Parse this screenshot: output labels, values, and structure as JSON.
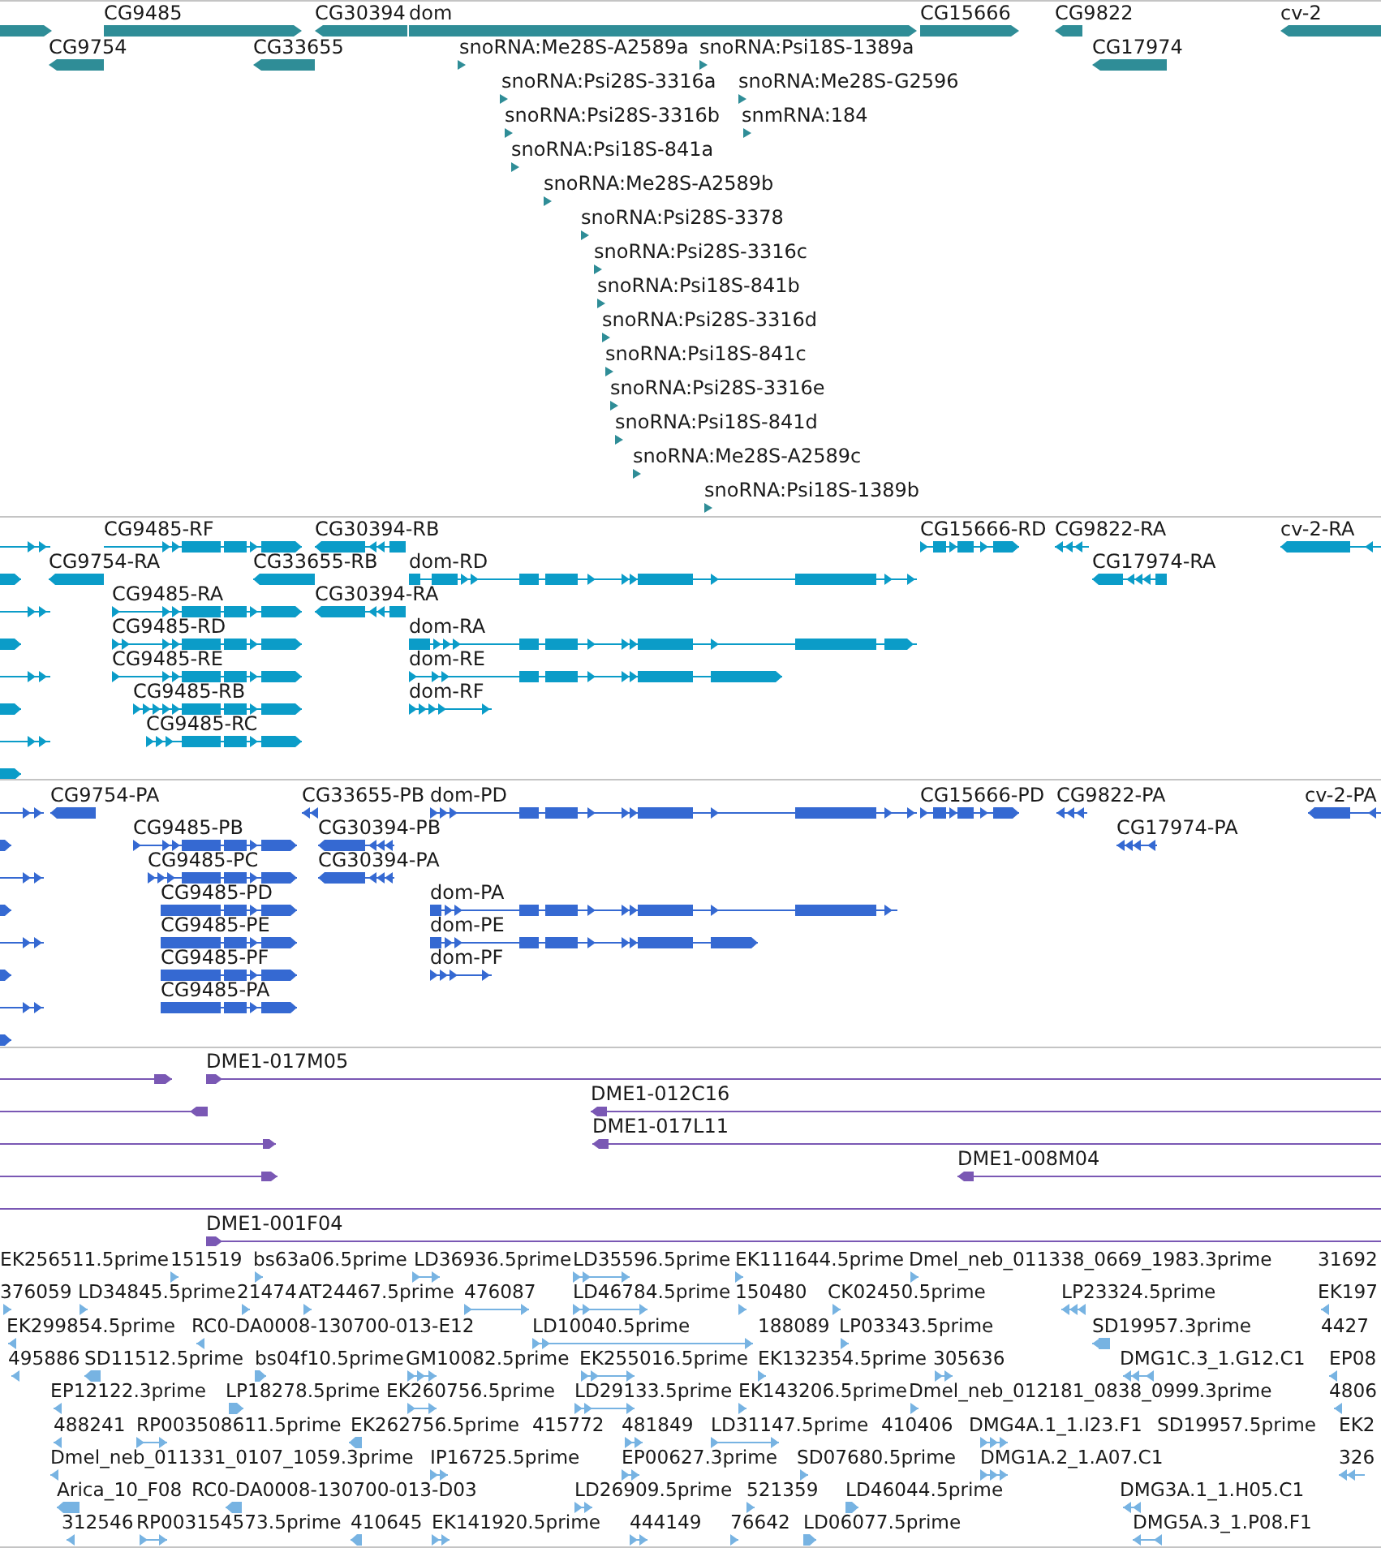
{
  "tracks": [
    {
      "kind": "gene",
      "features": [
        {
          "reverse": false
        },
        {
          "label": "CG9485",
          "reverse": false
        },
        {
          "label": "CG30394",
          "reverse": true
        },
        {
          "label": "dom",
          "reverse": false
        },
        {
          "label": "CG15666",
          "reverse": false
        },
        {
          "label": "CG9822",
          "reverse": true
        },
        {
          "label": "cv-2",
          "reverse": true
        },
        {
          "label": "CG9754",
          "reverse": true
        },
        {
          "label": "CG33655",
          "reverse": true
        },
        {
          "label": "snoRNA:Me28S-A2589a",
          "reverse": false
        },
        {
          "label": "snoRNA:Psi18S-1389a",
          "reverse": false
        },
        {
          "label": "CG17974",
          "reverse": true
        },
        {
          "label": "snoRNA:Psi28S-3316a",
          "reverse": false
        },
        {
          "label": "snoRNA:Me28S-G2596",
          "reverse": false
        },
        {
          "label": "snoRNA:Psi28S-3316b",
          "reverse": false
        },
        {
          "label": "snmRNA:184",
          "reverse": false
        },
        {
          "label": "snoRNA:Psi18S-841a",
          "reverse": false
        },
        {
          "label": "snoRNA:Me28S-A2589b",
          "reverse": false
        },
        {
          "label": "snoRNA:Psi28S-3378",
          "reverse": false
        },
        {
          "label": "snoRNA:Psi28S-3316c",
          "reverse": false
        },
        {
          "label": "snoRNA:Psi18S-841b",
          "reverse": false
        },
        {
          "label": "snoRNA:Psi28S-3316d",
          "reverse": false
        },
        {
          "label": "snoRNA:Psi18S-841c",
          "reverse": false
        },
        {
          "label": "snoRNA:Psi28S-3316e",
          "reverse": false
        },
        {
          "label": "snoRNA:Psi18S-841d",
          "reverse": false
        },
        {
          "label": "snoRNA:Me28S-A2589c",
          "reverse": false
        },
        {
          "label": "snoRNA:Psi18S-1389b",
          "reverse": false
        }
      ]
    },
    {
      "kind": "transcript",
      "features": [
        {
          "reverse": false
        },
        {
          "label": "CG9485-RF",
          "reverse": false
        },
        {
          "label": "CG30394-RB",
          "reverse": true
        },
        {
          "label": "CG15666-RD",
          "reverse": false
        },
        {
          "label": "CG9822-RA",
          "reverse": true
        },
        {
          "label": "cv-2-RA",
          "reverse": true
        },
        {
          "reverse": false
        },
        {
          "label": "CG9754-RA",
          "reverse": true
        },
        {
          "label": "CG33655-RB",
          "reverse": true
        },
        {
          "label": "dom-RD",
          "reverse": false
        },
        {
          "label": "CG17974-RA",
          "reverse": true
        },
        {
          "reverse": false
        },
        {
          "label": "CG9485-RA",
          "reverse": false
        },
        {
          "label": "CG30394-RA",
          "reverse": true
        },
        {
          "reverse": false
        },
        {
          "label": "CG9485-RD",
          "reverse": false
        },
        {
          "label": "dom-RA",
          "reverse": false
        },
        {
          "reverse": false
        },
        {
          "label": "CG9485-RE",
          "reverse": false
        },
        {
          "label": "dom-RE",
          "reverse": false
        },
        {
          "reverse": false
        },
        {
          "label": "CG9485-RB",
          "reverse": false
        },
        {
          "label": "dom-RF",
          "reverse": false
        },
        {
          "reverse": false
        },
        {
          "label": "CG9485-RC",
          "reverse": false
        },
        {
          "reverse": false
        }
      ]
    },
    {
      "kind": "protein",
      "features": [
        {
          "reverse": false
        },
        {
          "label": "CG9754-PA",
          "reverse": true
        },
        {
          "label": "CG33655-PB",
          "reverse": true
        },
        {
          "label": "dom-PD",
          "reverse": false
        },
        {
          "label": "CG15666-PD",
          "reverse": false
        },
        {
          "label": "CG9822-PA",
          "reverse": true
        },
        {
          "label": "cv-2-PA",
          "reverse": true
        },
        {
          "reverse": false
        },
        {
          "label": "CG9485-PB",
          "reverse": false
        },
        {
          "label": "CG30394-PB",
          "reverse": true
        },
        {
          "label": "CG17974-PA",
          "reverse": true
        },
        {
          "reverse": false
        },
        {
          "label": "CG9485-PC",
          "reverse": false
        },
        {
          "label": "CG30394-PA",
          "reverse": true
        },
        {
          "reverse": false
        },
        {
          "label": "CG9485-PD",
          "reverse": false
        },
        {
          "label": "dom-PA",
          "reverse": false
        },
        {
          "reverse": false
        },
        {
          "label": "CG9485-PE",
          "reverse": false
        },
        {
          "label": "dom-PE",
          "reverse": false
        },
        {
          "reverse": false
        },
        {
          "label": "CG9485-PF",
          "reverse": false
        },
        {
          "label": "dom-PF",
          "reverse": false
        },
        {
          "reverse": false
        },
        {
          "label": "CG9485-PA",
          "reverse": false
        },
        {
          "reverse": false
        }
      ]
    },
    {
      "kind": "clone",
      "features": [
        {
          "reverse": false
        },
        {
          "label": "DME1-017M05",
          "reverse": false
        },
        {
          "reverse": true
        },
        {
          "label": "DME1-012C16",
          "reverse": true
        },
        {
          "reverse": false
        },
        {
          "label": "DME1-017L11",
          "reverse": true
        },
        {
          "reverse": false
        },
        {
          "label": "DME1-008M04",
          "reverse": true
        },
        {
          "reverse": false
        },
        {
          "label": "DME1-001F04",
          "reverse": false
        }
      ]
    },
    {
      "kind": "est",
      "features": [
        {
          "label": "EK256511.5prime"
        },
        {
          "label": "151519",
          "reverse": false
        },
        {
          "label": "bs63a06.5prime",
          "reverse": false
        },
        {
          "label": "LD36936.5prime",
          "reverse": false
        },
        {
          "label": "LD35596.5prime",
          "reverse": false
        },
        {
          "label": "EK111644.5prime",
          "reverse": false
        },
        {
          "label": "Dmel_neb_011338_0669_1983.3prime",
          "reverse": false
        },
        {
          "label": "31692"
        },
        {
          "label": "376059",
          "reverse": false
        },
        {
          "label": "LD34845.5prime",
          "reverse": false
        },
        {
          "label": "21474",
          "reverse": false
        },
        {
          "label": "AT24467.5prime",
          "reverse": false
        },
        {
          "label": "476087",
          "reverse": false
        },
        {
          "label": "LD46784.5prime",
          "reverse": false
        },
        {
          "label": "150480",
          "reverse": false
        },
        {
          "label": "CK02450.5prime",
          "reverse": false
        },
        {
          "label": "LP23324.5prime",
          "reverse": true
        },
        {
          "label": "EK197",
          "reverse": true
        },
        {
          "label": "EK299854.5prime",
          "reverse": true
        },
        {
          "label": "RC0-DA0008-130700-013-E12",
          "reverse": true
        },
        {
          "label": "LD10040.5prime",
          "reverse": false
        },
        {
          "label": "188089"
        },
        {
          "label": "LP03343.5prime",
          "reverse": false
        },
        {
          "label": "SD19957.3prime",
          "reverse": true
        },
        {
          "label": "4427"
        },
        {
          "label": "495886",
          "reverse": true
        },
        {
          "label": "SD11512.5prime",
          "reverse": true
        },
        {
          "label": "bs04f10.5prime",
          "reverse": false
        },
        {
          "label": "GM10082.5prime",
          "reverse": false
        },
        {
          "label": "EK255016.5prime",
          "reverse": false
        },
        {
          "label": "EK132354.5prime",
          "reverse": false
        },
        {
          "label": "305636",
          "reverse": false
        },
        {
          "label": "DMG1C.3_1.G12.C1",
          "reverse": true
        },
        {
          "label": "EP08",
          "reverse": true
        },
        {
          "label": "EP12122.3prime",
          "reverse": true
        },
        {
          "label": "LP18278.5prime",
          "reverse": false
        },
        {
          "label": "EK260756.5prime",
          "reverse": false
        },
        {
          "label": "LD29133.5prime",
          "reverse": false
        },
        {
          "label": "EK143206.5prime",
          "reverse": false
        },
        {
          "label": "Dmel_neb_012181_0838_0999.3prime",
          "reverse": false
        },
        {
          "label": "4806",
          "reverse": true
        },
        {
          "label": "488241",
          "reverse": true
        },
        {
          "label": "RP003508611.5prime",
          "reverse": false
        },
        {
          "label": "EK262756.5prime",
          "reverse": true
        },
        {
          "label": "415772"
        },
        {
          "label": "481849",
          "reverse": false
        },
        {
          "label": "LD31147.5prime",
          "reverse": false
        },
        {
          "label": "410406"
        },
        {
          "label": "DMG4A.1_1.I23.F1",
          "reverse": false
        },
        {
          "label": "SD19957.5prime"
        },
        {
          "label": "EK2"
        },
        {
          "label": "Dmel_neb_011331_0107_1059.3prime",
          "reverse": true
        },
        {
          "label": "IP16725.5prime",
          "reverse": false
        },
        {
          "label": "EP00627.3prime",
          "reverse": false
        },
        {
          "label": "SD07680.5prime",
          "reverse": false
        },
        {
          "label": "DMG1A.2_1.A07.C1",
          "reverse": false
        },
        {
          "label": "326",
          "reverse": true
        },
        {
          "label": "Arica_10_F08",
          "reverse": true
        },
        {
          "label": "RC0-DA0008-130700-013-D03",
          "reverse": true
        },
        {
          "label": "LD26909.5prime",
          "reverse": false
        },
        {
          "label": "521359",
          "reverse": false
        },
        {
          "label": "LD46044.5prime",
          "reverse": false
        },
        {
          "label": "DMG3A.1_1.H05.C1",
          "reverse": true
        },
        {
          "label": "312546",
          "reverse": true
        },
        {
          "label": "RP003154573.5prime",
          "reverse": false
        },
        {
          "label": "410645",
          "reverse": true
        },
        {
          "label": "EK141920.5prime",
          "reverse": false
        },
        {
          "label": "444149",
          "reverse": false
        },
        {
          "label": "76642",
          "reverse": false
        },
        {
          "label": "LD06077.5prime",
          "reverse": false
        },
        {
          "label": "DMG5A.3_1.P08.F1",
          "reverse": true
        }
      ]
    }
  ]
}
